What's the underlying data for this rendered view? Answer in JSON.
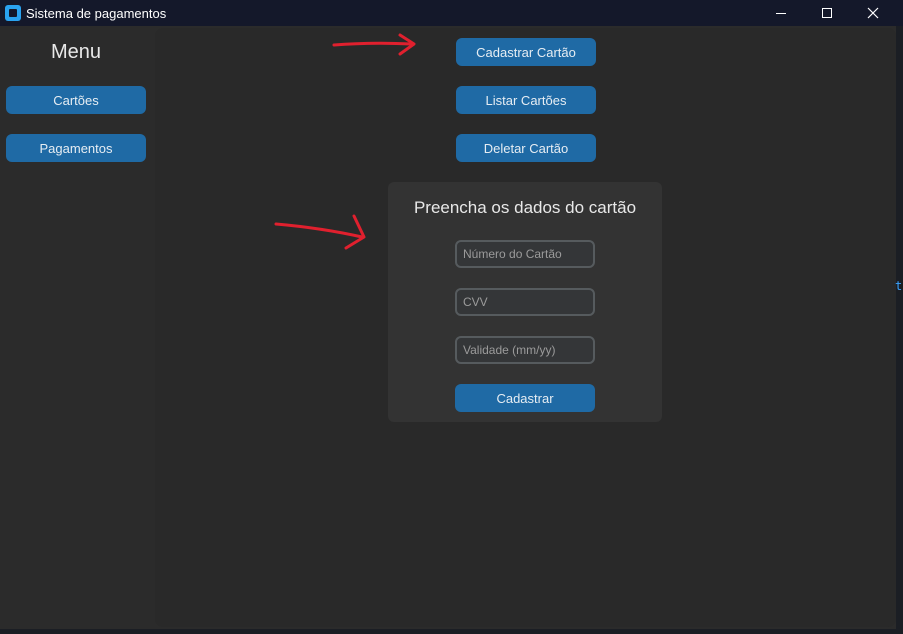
{
  "window": {
    "title": "Sistema de pagamentos",
    "controls": [
      "minimize-icon",
      "maximize-icon",
      "close-icon"
    ]
  },
  "sidebar": {
    "title": "Menu",
    "items": [
      {
        "label": "Cartões"
      },
      {
        "label": "Pagamentos"
      }
    ]
  },
  "actions": {
    "register": "Cadastrar Cartão",
    "list": "Listar Cartões",
    "delete": "Deletar Cartão"
  },
  "form": {
    "title": "Preencha os dados do cartão",
    "card_number_placeholder": "Número do Cartão",
    "cvv_placeholder": "CVV",
    "expiry_placeholder": "Validade (mm/yy)",
    "submit_label": "Cadastrar"
  },
  "edge_fragment": "t",
  "colors": {
    "button": "#1f6aa5",
    "panel": "#333333",
    "background": "#2b2b2b",
    "annotation_arrow": "#e0202e",
    "titlebar": "#14182a"
  }
}
